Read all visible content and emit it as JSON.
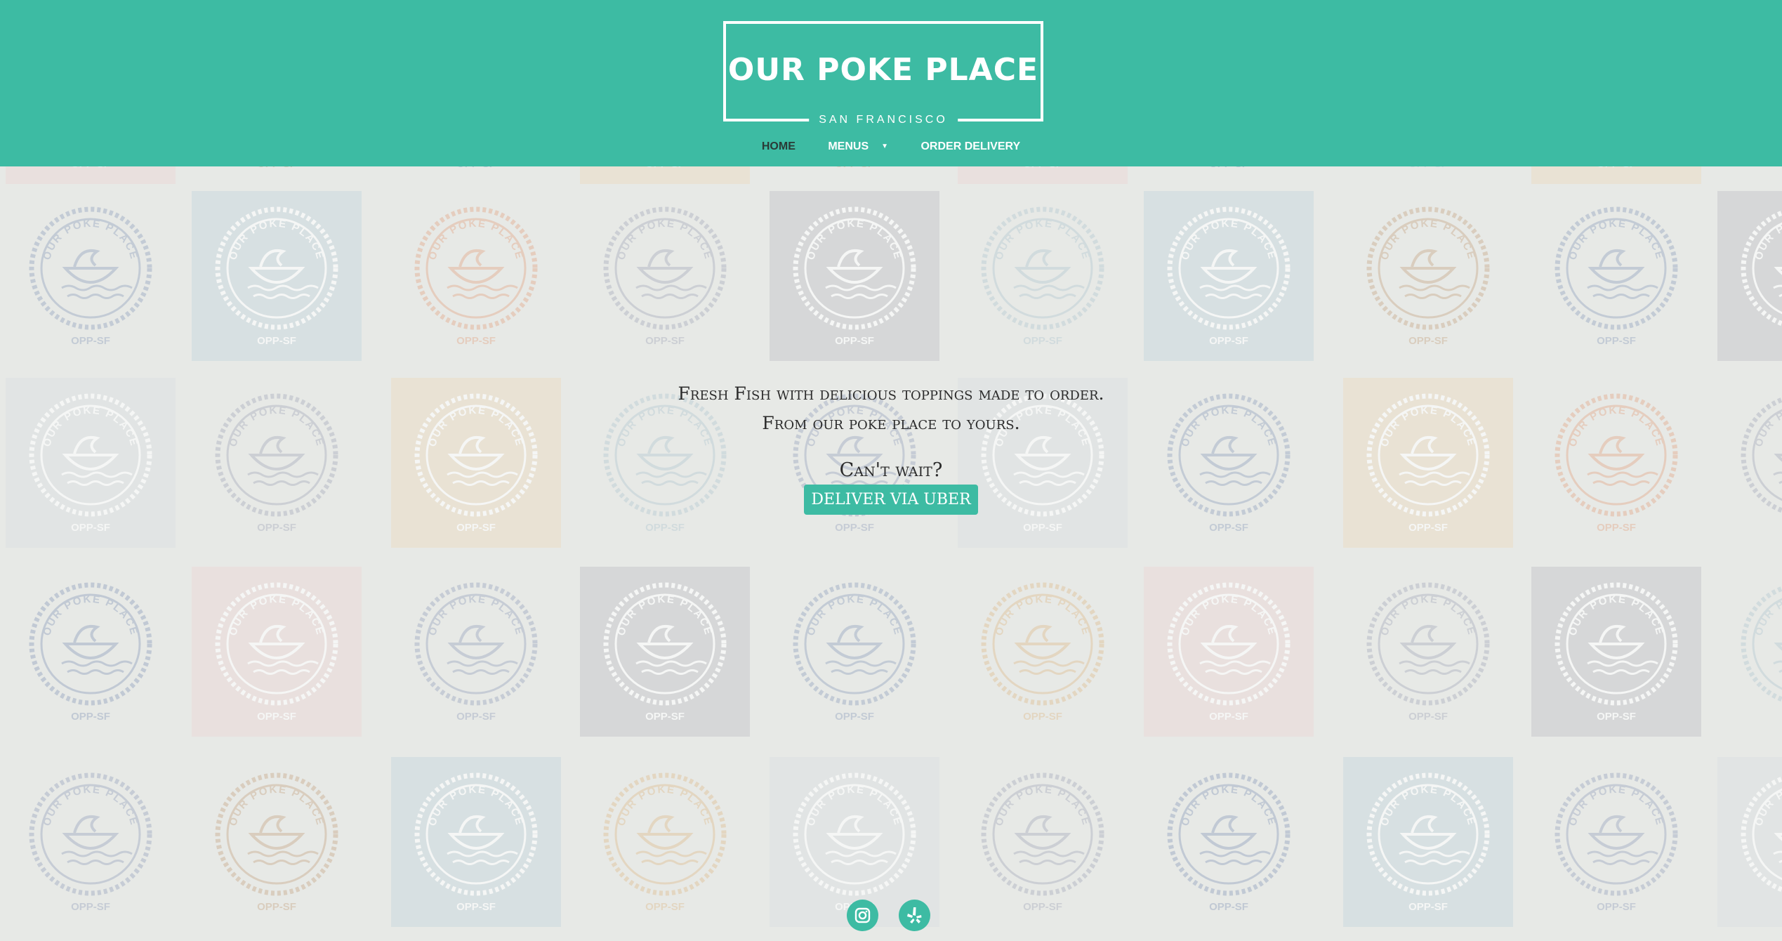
{
  "site": {
    "logo_title": "OUR POKE PLACE",
    "logo_subtitle": "SAN FRANCISCO",
    "brand_color": "#3dbba3"
  },
  "nav": {
    "items": [
      {
        "label": "HOME",
        "active": true
      },
      {
        "label": "MENUS",
        "dropdown": true
      },
      {
        "label": "ORDER DELIVERY"
      }
    ]
  },
  "hero": {
    "line1": "Fresh Fish with delicious toppings made to order.",
    "line2": "From our poke place to yours.",
    "cant_wait": "Can't wait?",
    "button": "DELIVER VIA UBER"
  },
  "background_tiles": {
    "badge_text": "OUR POKE PLACE",
    "tag": "OPP-SF",
    "colors": [
      "#ebdad8",
      "#ebdcc6",
      "#dde0e2",
      "#ccd9df",
      "#cacace"
    ]
  },
  "social": [
    {
      "icon": "instagram-icon"
    },
    {
      "icon": "yelp-icon"
    }
  ]
}
